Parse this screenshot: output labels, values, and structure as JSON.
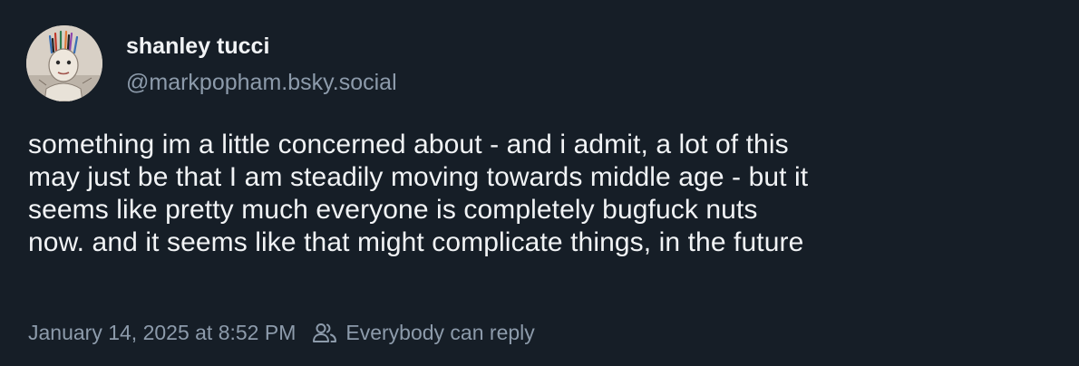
{
  "post": {
    "author": {
      "display_name": "shanley tucci",
      "handle": "@markpopham.bsky.social",
      "avatar_icon": "avatar-drawing"
    },
    "text_lines": [
      "something im a little concerned about - and i admit, a lot of this",
      "may just be that I am steadily moving towards middle age - but it",
      "seems like pretty much everyone is completely bugfuck nuts",
      "now. and it seems like that might complicate things, in the future"
    ],
    "timestamp": "January 14, 2025 at 8:52 PM",
    "reply_setting": "Everybody can reply",
    "reply_icon": "people-icon"
  },
  "colors": {
    "background": "#161e27",
    "text": "#f1f3f5",
    "muted": "#8d9bab"
  }
}
